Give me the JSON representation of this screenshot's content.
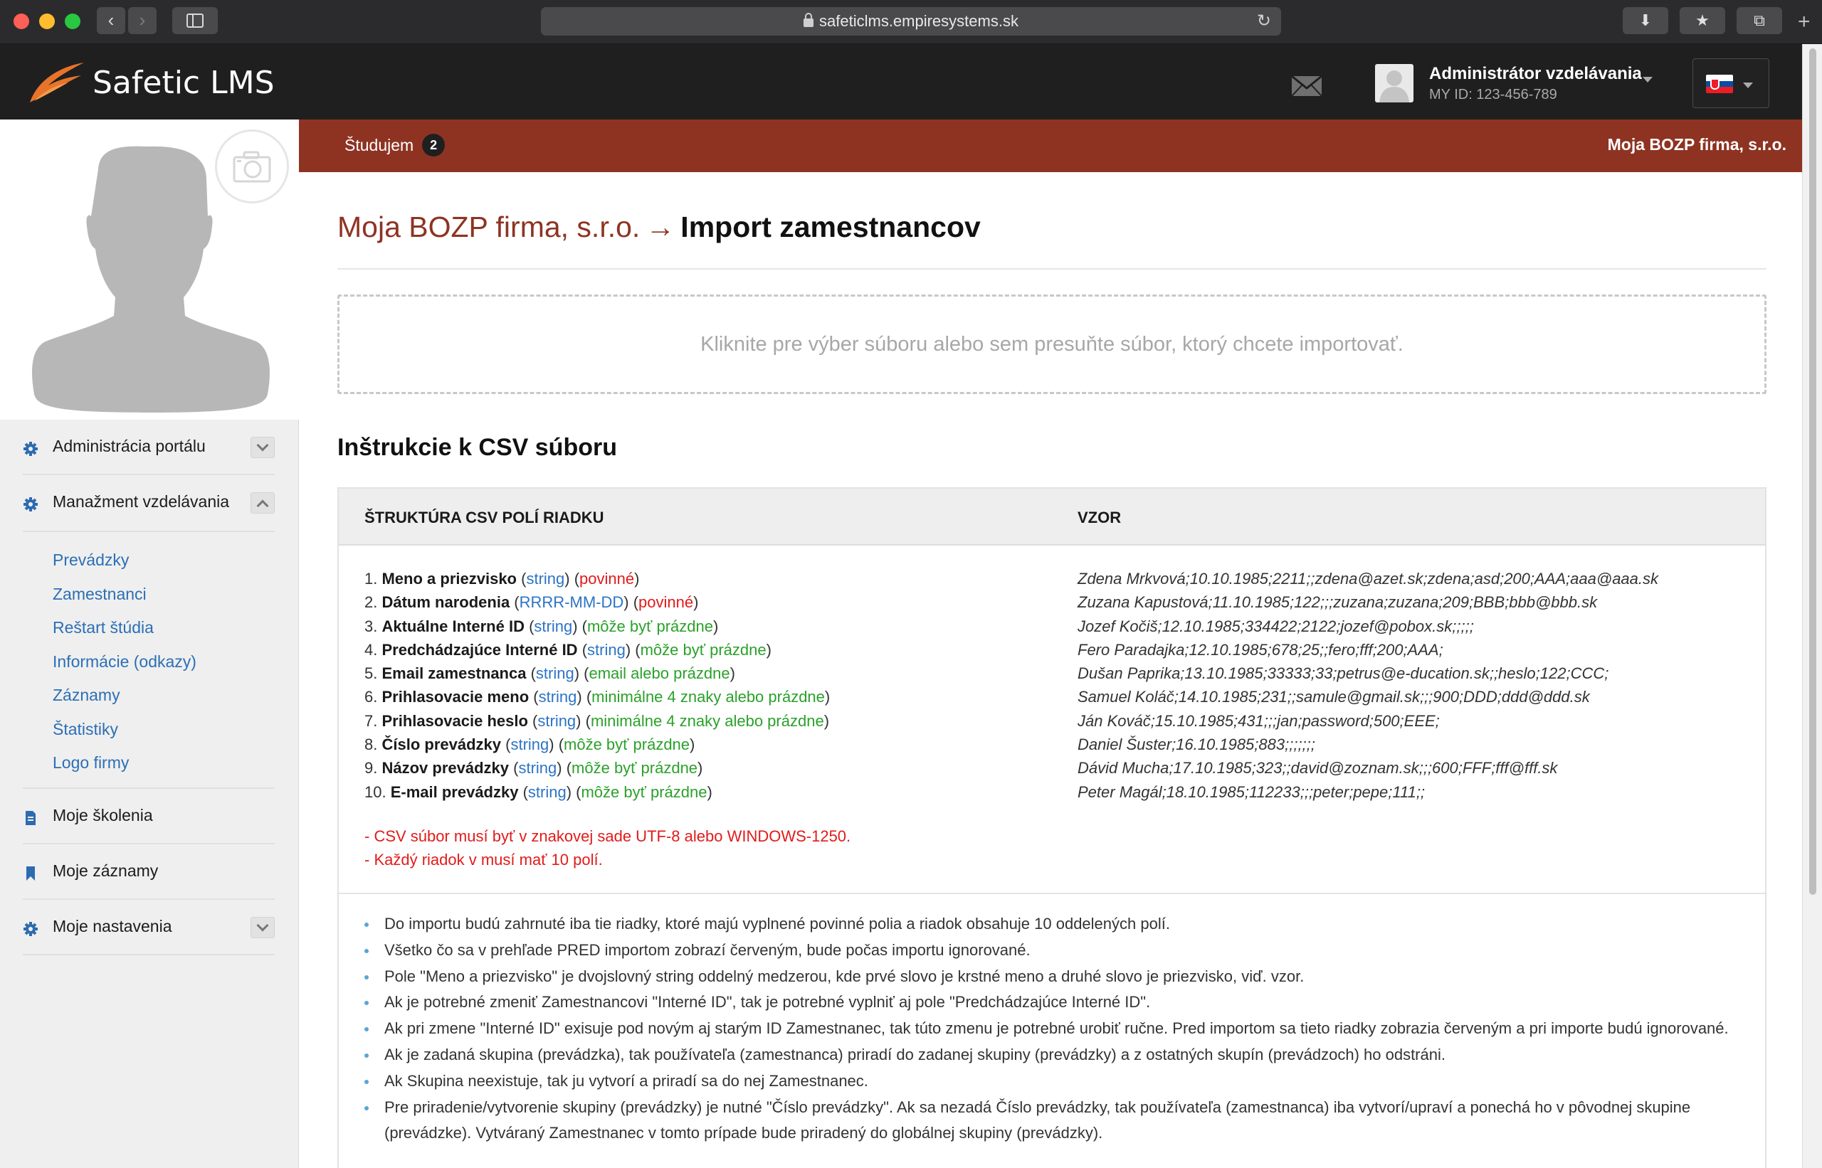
{
  "browser": {
    "url": "safeticlms.empiresystems.sk"
  },
  "header": {
    "logo_text": "Safetic LMS",
    "user_name": "Administrátor vzdelávania",
    "user_id": "MY ID: 123-456-789",
    "language": "SK"
  },
  "sidebar": {
    "menu": [
      {
        "label": "Administrácia portálu",
        "icon": "gear-icon",
        "toggle": "collapsed"
      },
      {
        "label": "Manažment vzdelávania",
        "icon": "gear-icon",
        "toggle": "expanded"
      }
    ],
    "submenu": [
      "Prevádzky",
      "Zamestnanci",
      "Reštart štúdia",
      "Informácie (odkazy)",
      "Záznamy",
      "Štatistiky",
      "Logo firmy"
    ],
    "menu_bottom": [
      {
        "label": "Moje školenia",
        "icon": "document-icon"
      },
      {
        "label": "Moje záznamy",
        "icon": "bookmark-icon"
      },
      {
        "label": "Moje nastavenia",
        "icon": "gear-icon",
        "toggle": "collapsed"
      }
    ]
  },
  "topbar": {
    "studying_label": "Študujem",
    "studying_count": "2",
    "company": "Moja BOZP firma, s.r.o."
  },
  "page": {
    "breadcrumb_link": "Moja BOZP firma, s.r.o.",
    "arrow": "→",
    "title": "Import zamestnancov",
    "dropzone_text": "Kliknite pre výber súboru alebo sem presuňte súbor, ktorý chcete importovať.",
    "section_title": "Inštrukcie k CSV súboru"
  },
  "csv": {
    "col1_header": "ŠTRUKTÚRA CSV POLÍ RIADKU",
    "col2_header": "VZOR",
    "fields": [
      {
        "num": "1.",
        "name": "Meno a priezvisko",
        "type": "string",
        "note": "povinné",
        "kind": "req"
      },
      {
        "num": "2.",
        "name": "Dátum narodenia",
        "type": "RRRR-MM-DD",
        "note": "povinné",
        "kind": "req"
      },
      {
        "num": "3.",
        "name": "Aktuálne Interné ID",
        "type": "string",
        "note": "môže byť prázdne",
        "kind": "opt"
      },
      {
        "num": "4.",
        "name": "Predchádzajúce Interné ID",
        "type": "string",
        "note": "môže byť prázdne",
        "kind": "opt"
      },
      {
        "num": "5.",
        "name": "Email zamestnanca",
        "type": "string",
        "note": "email alebo prázdne",
        "kind": "opt"
      },
      {
        "num": "6.",
        "name": "Prihlasovacie meno",
        "type": "string",
        "note": "minimálne 4 znaky alebo prázdne",
        "kind": "opt"
      },
      {
        "num": "7.",
        "name": "Prihlasovacie heslo",
        "type": "string",
        "note": "minimálne 4 znaky alebo prázdne",
        "kind": "opt"
      },
      {
        "num": "8.",
        "name": "Číslo prevádzky",
        "type": "string",
        "note": "môže byť prázdne",
        "kind": "opt"
      },
      {
        "num": "9.",
        "name": "Názov prevádzky",
        "type": "string",
        "note": "môže byť prázdne",
        "kind": "opt"
      },
      {
        "num": "10.",
        "name": "E-mail prevádzky",
        "type": "string",
        "note": "môže byť prázdne",
        "kind": "opt"
      }
    ],
    "samples": [
      "Zdena Mrkvová;10.10.1985;2211;;zdena@azet.sk;zdena;asd;200;AAA;aaa@aaa.sk",
      "Zuzana Kapustová;11.10.1985;122;;;zuzana;zuzana;209;BBB;bbb@bbb.sk",
      "Jozef Kočiš;12.10.1985;334422;2122;jozef@pobox.sk;;;;;",
      "Fero Paradajka;12.10.1985;678;25;;fero;fff;200;AAA;",
      "Dušan Paprika;13.10.1985;33333;33;petrus@e-ducation.sk;;heslo;122;CCC;",
      "Samuel Koláč;14.10.1985;231;;samule@gmail.sk;;;900;DDD;ddd@ddd.sk",
      "Ján Kováč;15.10.1985;431;;;jan;password;500;EEE;",
      "Daniel Šuster;16.10.1985;883;;;;;;;",
      "Dávid Mucha;17.10.1985;323;;david@zoznam.sk;;;600;FFF;fff@fff.sk",
      "Peter Magál;18.10.1985;112233;;;peter;pepe;111;;"
    ],
    "warnings": [
      "- CSV súbor musí byť v znakovej sade UTF-8 alebo WINDOWS-1250.",
      "- Každý riadok v musí mať 10 polí."
    ],
    "notes": [
      "Do importu budú zahrnuté iba tie riadky, ktoré majú vyplnené povinné polia a riadok obsahuje 10 oddelených polí.",
      "Všetko čo sa v prehľade PRED importom zobrazí červeným, bude počas importu ignorované.",
      "Pole \"Meno a priezvisko\" je dvojslovný string oddelný medzerou, kde prvé slovo je krstné meno a druhé slovo je priezvisko, viď. vzor.",
      "Ak je potrebné zmeniť Zamestnancovi \"Interné ID\", tak je potrebné vyplniť aj pole \"Predchádzajúce Interné ID\".",
      "Ak pri zmene \"Interné ID\" exisuje pod novým aj starým ID Zamestnanec, tak túto zmenu je potrebné urobiť ručne. Pred importom sa tieto riadky zobrazia červeným a pri importe budú ignorované.",
      "Ak je zadaná skupina (prevádzka), tak používateľa (zamestnanca) priradí do zadanej skupiny (prevádzky) a z ostatných skupín (prevádzoch) ho odstráni.",
      "Ak Skupina neexistuje, tak ju vytvorí a priradí sa do nej Zamestnanec.",
      "Pre priradenie/vytvorenie skupiny (prevádzky) je nutné \"Číslo prevádzky\". Ak sa nezadá Číslo prevádzky, tak používateľa (zamestnanca) iba vytvorí/upraví a ponechá ho v pôvodnej skupine (prevádzke). Vytváraný Zamestnanec v tomto prípade bude priradený do globálnej skupiny (prevádzky)."
    ]
  }
}
